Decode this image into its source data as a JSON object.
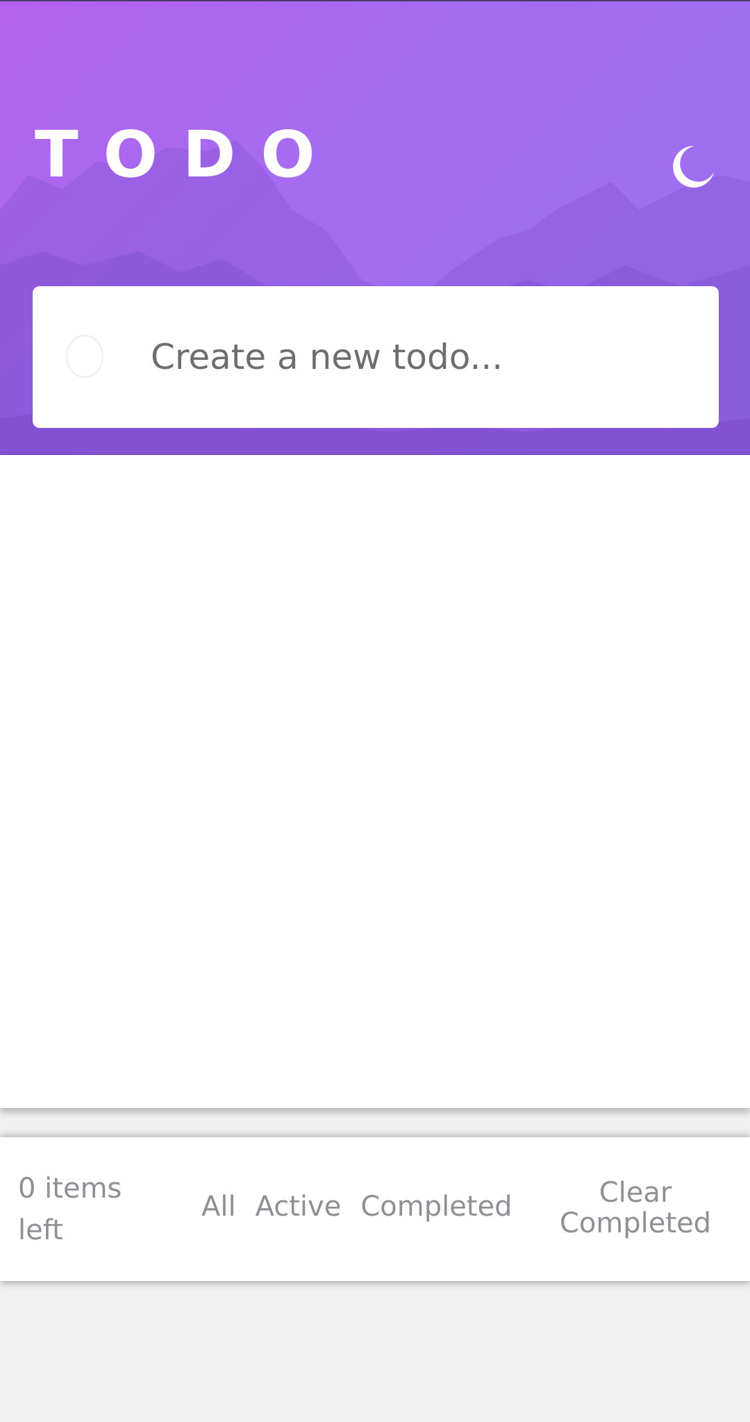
{
  "header": {
    "title": "TODO",
    "theme_toggle_icon": "moon-icon"
  },
  "new_todo": {
    "placeholder": "Create a new todo...",
    "value": ""
  },
  "footer": {
    "items_left": "0 items left",
    "filters": [
      {
        "label": "All"
      },
      {
        "label": "Active"
      },
      {
        "label": "Completed"
      }
    ],
    "clear_completed": "Clear Completed"
  },
  "colors": {
    "hero_start": "#b462ee",
    "hero_end": "#9a70f2",
    "text_muted": "#8f8f96",
    "background": "#f1f1f1"
  }
}
